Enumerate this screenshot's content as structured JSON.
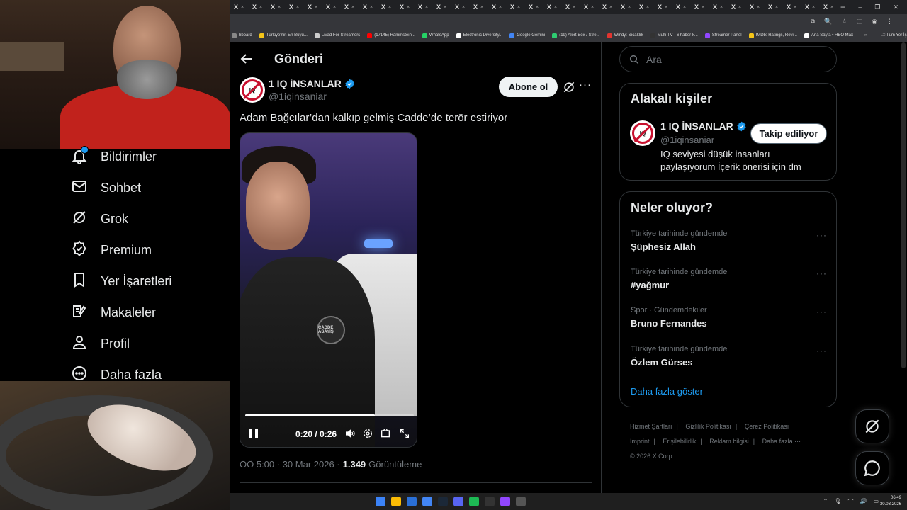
{
  "browser": {
    "tab_icon": "X",
    "tab_count": 33,
    "new_tab": "+",
    "window_controls": [
      "–",
      "❐",
      "✕"
    ],
    "address_icons": [
      "⧉",
      "🔍",
      "☆",
      "⬚",
      "◉",
      "⋮"
    ]
  },
  "bookmarks": [
    {
      "label": "hboard",
      "color": "#888888"
    },
    {
      "label": "Türkiye'nin En Büyü...",
      "color": "#f5c518"
    },
    {
      "label": "Livad For Streamers",
      "color": "#cccccc"
    },
    {
      "label": "(17145) Rammstein...",
      "color": "#ff0000"
    },
    {
      "label": "WhatsApp",
      "color": "#25d366"
    },
    {
      "label": "Electronic Diversity...",
      "color": "#ffffff"
    },
    {
      "label": "Google Gemini",
      "color": "#4285f4"
    },
    {
      "label": "(19) Alert Box / Stre...",
      "color": "#2ecc71"
    },
    {
      "label": "Windy: Sıcaklık",
      "color": "#e3342f"
    },
    {
      "label": "Multi TV - 6 haber k...",
      "color": "#333333"
    },
    {
      "label": "Streamer Panel",
      "color": "#9146ff"
    },
    {
      "label": "IMDb: Ratings, Revi...",
      "color": "#f5c518"
    },
    {
      "label": "Ana Sayfa • HBO Max",
      "color": "#ffffff"
    }
  ],
  "bookmarks_folder": "Tüm Yer İşaretleri",
  "nav": {
    "items": [
      {
        "label": "Bildirimler",
        "icon": "bell-icon"
      },
      {
        "label": "Sohbet",
        "icon": "mail-icon"
      },
      {
        "label": "Grok",
        "icon": "grok-icon"
      },
      {
        "label": "Premium",
        "icon": "premium-icon"
      },
      {
        "label": "Yer İşaretleri",
        "icon": "bookmark-icon"
      },
      {
        "label": "Makaleler",
        "icon": "articles-icon"
      },
      {
        "label": "Profil",
        "icon": "profile-icon"
      },
      {
        "label": "Daha fazla",
        "icon": "more-circle-icon"
      }
    ]
  },
  "post": {
    "header_title": "Gönderi",
    "author_name": "1 IQ İNSANLAR",
    "author_handle": "@1iqinsaniar",
    "subscribe_label": "Abone ol",
    "text": "Adam Bağcılar’dan kalkıp gelmiş Cadde’de terör estiriyor",
    "video": {
      "time": "0:20 / 0:26",
      "progress": 0.77,
      "badge": "CADDE ASAYİŞ"
    },
    "timestamp": "ÖÖ 5:00 · 30 Mar 2026 ·",
    "views": "1.349",
    "views_label": "Görüntüleme"
  },
  "right": {
    "search_placeholder": "Ara",
    "related": {
      "title": "Alakalı kişiler",
      "name": "1 IQ İNSANLAR",
      "handle": "@1iqinsaniar",
      "follow_label": "Takip ediliyor",
      "bio": "IQ seviyesi düşük insanları paylaşıyorum İçerik önerisi için dm"
    },
    "trends_title": "Neler oluyor?",
    "trends": [
      {
        "context": "Türkiye tarihinde gündemde",
        "name": "Şüphesiz Allah"
      },
      {
        "context": "Türkiye tarihinde gündemde",
        "name": "#yağmur"
      },
      {
        "context": "Spor · Gündemdekiler",
        "name": "Bruno Fernandes"
      },
      {
        "context": "Türkiye tarihinde gündemde",
        "name": "Özlem Gürses"
      }
    ],
    "show_more": "Daha fazla göster",
    "footer_links": [
      "Hizmet Şartları",
      "Gizlilik Politikası",
      "Çerez Politikası",
      "Imprint",
      "Erişilebilirlik",
      "Reklam bilgisi",
      "Daha fazla ···"
    ],
    "copyright": "© 2026 X Corp."
  },
  "taskbar": {
    "clock_time": "06:49",
    "clock_date": "30.03.2026",
    "icons": [
      "#3b82f6",
      "#fbbc05",
      "#2a6fd6",
      "#4285f4",
      "#1b2838",
      "#5865f2",
      "#1db954",
      "#333333",
      "#9146ff",
      "#555555"
    ]
  },
  "colors": {
    "accent": "#1d9bf0",
    "background": "#000000",
    "border": "#2f3336",
    "muted": "#71767b"
  }
}
